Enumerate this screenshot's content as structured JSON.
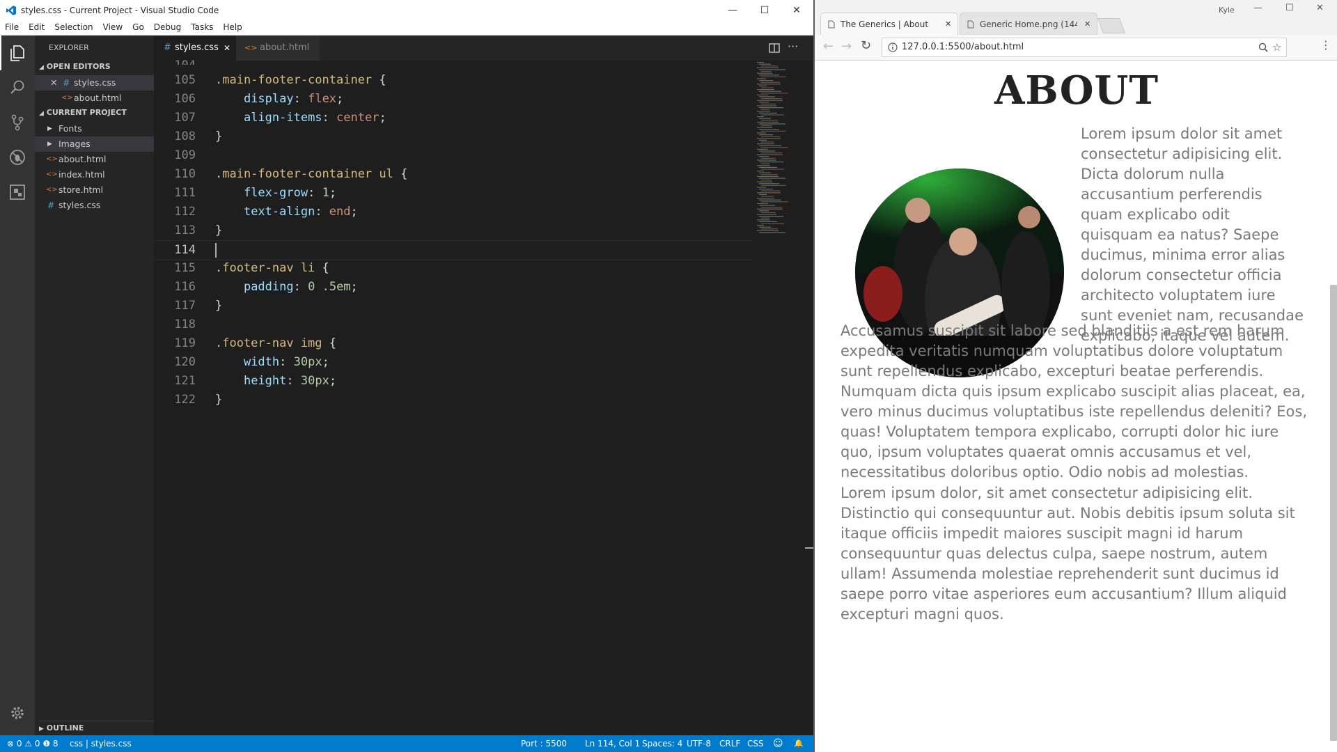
{
  "vscode": {
    "title": "styles.css - Current Project - Visual Studio Code",
    "window_controls": {
      "minimize": "—",
      "maximize": "☐",
      "close": "✕"
    },
    "menu": [
      "File",
      "Edit",
      "Selection",
      "View",
      "Go",
      "Debug",
      "Tasks",
      "Help"
    ],
    "activity_icons": [
      "files-icon",
      "search-icon",
      "source-control-icon",
      "debug-icon",
      "extensions-icon",
      "gear-icon"
    ],
    "explorer": {
      "header": "EXPLORER",
      "open_editors_label": "OPEN EDITORS",
      "open_editors": [
        {
          "name": "styles.css",
          "icon": "#",
          "prefix": "✕"
        },
        {
          "name": "about.html",
          "icon": "<>"
        }
      ],
      "project_label": "CURRENT PROJECT",
      "folders": [
        "Fonts",
        "Images"
      ],
      "files": [
        {
          "name": "about.html",
          "icon": "<>"
        },
        {
          "name": "index.html",
          "icon": "<>"
        },
        {
          "name": "store.html",
          "icon": "<>"
        },
        {
          "name": "styles.css",
          "icon": "#"
        }
      ],
      "outline_label": "OUTLINE"
    },
    "tabs": [
      {
        "label": "styles.css",
        "icon": "#",
        "close": "✕"
      },
      {
        "label": "about.html",
        "icon": "<>"
      }
    ],
    "code_lines": [
      {
        "n": "105",
        "t": ".main-footer-container {"
      },
      {
        "n": "106",
        "t": "    display: flex;"
      },
      {
        "n": "107",
        "t": "    align-items: center;"
      },
      {
        "n": "108",
        "t": "}"
      },
      {
        "n": "109",
        "t": ""
      },
      {
        "n": "110",
        "t": ".main-footer-container ul {"
      },
      {
        "n": "111",
        "t": "    flex-grow: 1;"
      },
      {
        "n": "112",
        "t": "    text-align: end;"
      },
      {
        "n": "113",
        "t": "}"
      },
      {
        "n": "114",
        "t": ""
      },
      {
        "n": "115",
        "t": ".footer-nav li {"
      },
      {
        "n": "116",
        "t": "    padding: 0 .5em;"
      },
      {
        "n": "117",
        "t": "}"
      },
      {
        "n": "118",
        "t": ""
      },
      {
        "n": "119",
        "t": ".footer-nav img {"
      },
      {
        "n": "120",
        "t": "    width: 30px;"
      },
      {
        "n": "121",
        "t": "    height: 30px;"
      },
      {
        "n": "122",
        "t": "}"
      }
    ],
    "current_line": "114",
    "status": {
      "problems": "⊗ 0 ⚠ 0 ❶ 8",
      "lang_path": "css | styles.css",
      "port": "Port : 5500",
      "cursor": "Ln 114, Col 1",
      "spaces": "Spaces: 4",
      "encoding": "UTF-8",
      "eol": "CRLF",
      "language": "CSS",
      "smiley": "☺",
      "bell": "🔔"
    }
  },
  "chrome": {
    "tabs": [
      {
        "label": "The Generics | About",
        "close": "✕"
      },
      {
        "label": "Generic Home.png (144(",
        "close": "✕"
      }
    ],
    "url": "127.0.0.1:5500/about.html",
    "user_label": "Kyle",
    "page": {
      "title": "ABOUT",
      "para1": "Lorem ipsum dolor sit amet consectetur adipisicing elit. Dicta dolorum nulla accusantium perferendis quam explicabo odit quisquam ea natus? Saepe ducimus, minima error alias dolorum consectetur officia architecto voluptatem iure sunt eveniet nam, recusandae explicabo, itaque vel autem.",
      "para1_rest": "Accusamus suscipit sit labore sed blanditiis a est rem harum expedita veritatis numquam voluptatibus dolore voluptatum sunt repellendus explicabo, excepturi beatae perferendis. Numquam dicta quis ipsum explicabo suscipit alias placeat, ea, vero minus ducimus voluptatibus iste repellendus deleniti? Eos, quas! Voluptatem tempora explicabo, corrupti dolor hic iure quo, ipsum voluptates quaerat omnis accusamus et vel, necessitatibus doloribus optio. Odio nobis ad molestias.",
      "para2": "Lorem ipsum dolor, sit amet consectetur adipisicing elit. Distinctio qui consequuntur aut. Nobis debitis ipsum soluta sit itaque officiis impedit maiores suscipit magni id harum consequuntur quas delectus culpa, saepe nostrum, autem ullam! Assumenda molestiae reprehenderit sunt ducimus id saepe porro vitae asperiores eum accusantium? Illum aliquid excepturi magni quos."
    }
  }
}
